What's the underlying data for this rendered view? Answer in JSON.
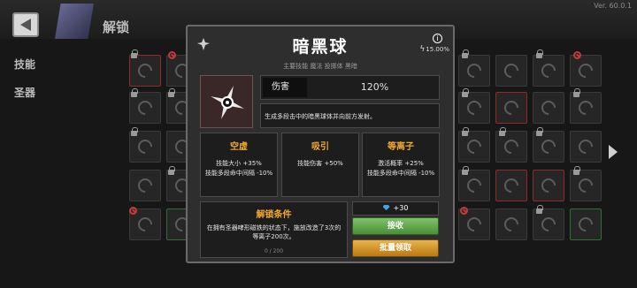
{
  "version": "Ver. 60.0.1",
  "page_title": "解锁",
  "side_tabs": [
    "技能",
    "圣器"
  ],
  "modal": {
    "title": "暗黑球",
    "rate": "15.00%",
    "tags": "主要技能  魔法  投掷体  黑暗",
    "damage_label": "伤害",
    "damage_value": "120%",
    "description": "生成多段击中的暗黑球体并向前方发射。",
    "mods": [
      {
        "name": "空虚",
        "lines": [
          "技能大小 +35%",
          "技能多段命中间隔 -10%"
        ]
      },
      {
        "name": "吸引",
        "lines": [
          "技能伤害 +50%"
        ]
      },
      {
        "name": "等离子",
        "lines": [
          "激活概率 +25%",
          "技能多段命中间隔 -10%"
        ]
      }
    ],
    "unlock": {
      "title": "解锁条件",
      "text": "在拥有圣器哮形磁铁的状态下，施放改造了3次的等离子200次。",
      "progress": "0 / 200"
    },
    "reward": "+30",
    "claim_label": "接收",
    "batch_label": "批量领取"
  },
  "colors": {
    "accent_orange": "#f0a830",
    "claim_green": "#5fa84a",
    "batch_gold": "#d69a2c"
  }
}
